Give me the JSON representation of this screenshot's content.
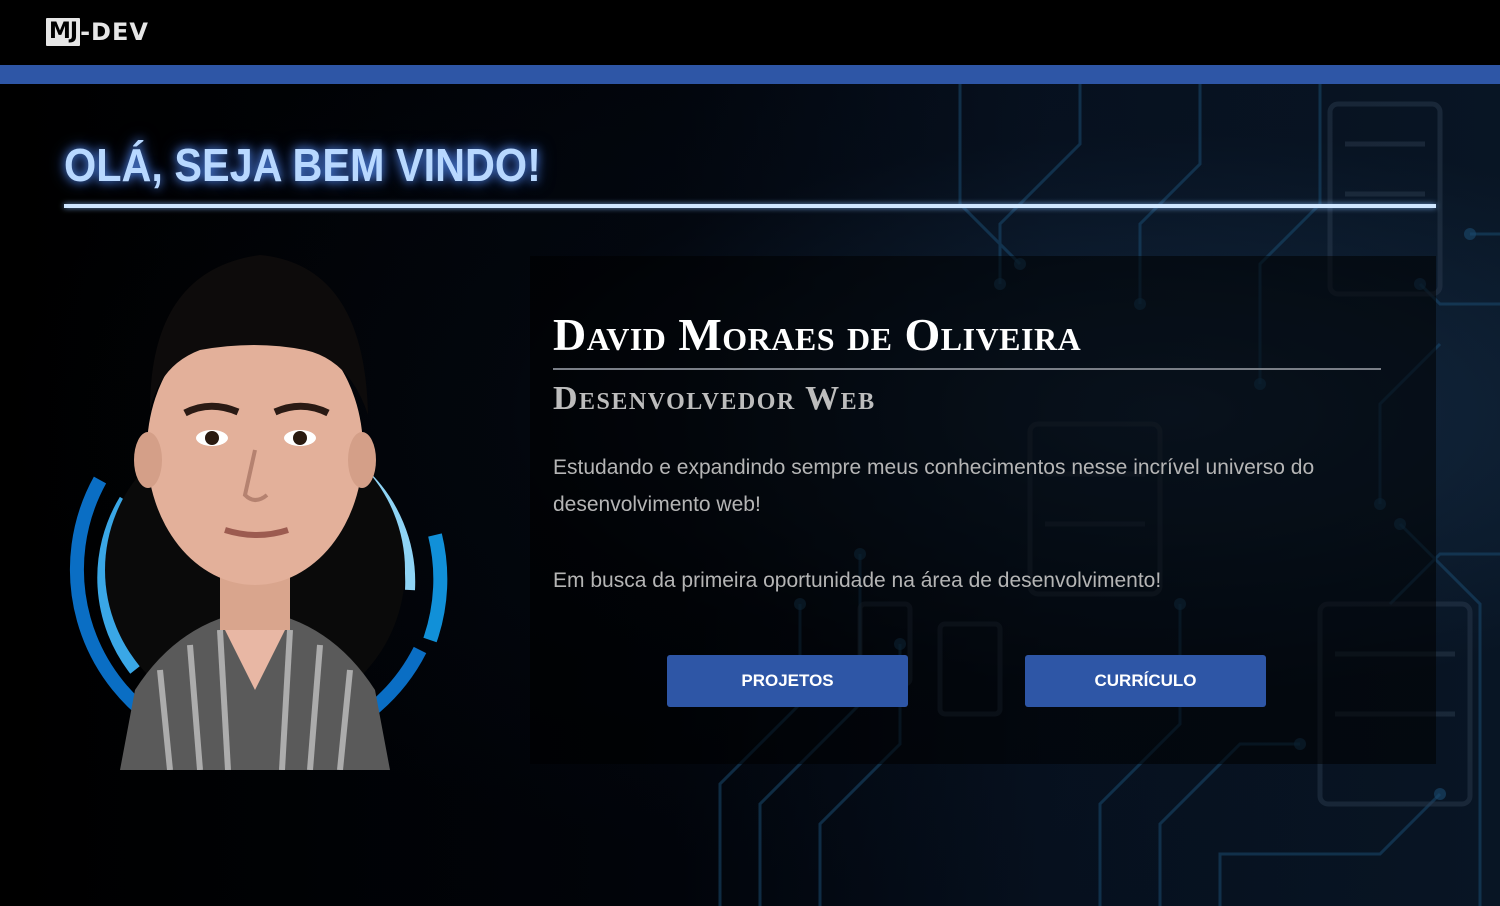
{
  "header": {
    "logo_box": "MJ",
    "logo_text": "-DEV"
  },
  "hero": {
    "welcome": "OLÁ, SEJA BEM VINDO!"
  },
  "profile": {
    "name": "David Moraes de Oliveira",
    "role": "Desenvolvedor Web",
    "paragraphs": [
      "Estudando e expandindo sempre meus conhecimentos nesse incrível universo do desenvolvimento web!",
      "Em busca da primeira oportunidade na área de desenvolvimento!"
    ]
  },
  "buttons": {
    "projects": "PROJETOS",
    "resume": "CURRÍCULO"
  },
  "colors": {
    "accent_blue": "#2e56a6",
    "welcome_glow": "#b8d8ff",
    "ring_dark": "#0a6ec4",
    "ring_light": "#4fc0f0"
  }
}
